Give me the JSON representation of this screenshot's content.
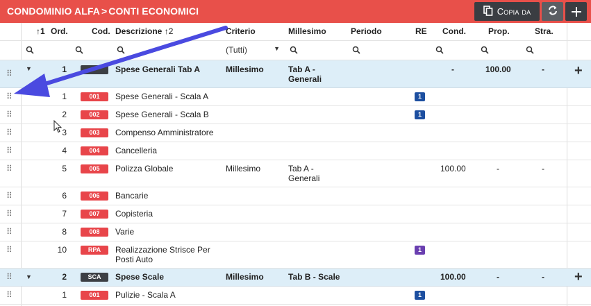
{
  "header": {
    "breadcrumb": [
      "CONDOMINIO ALFA",
      "CONTI ECONOMICI"
    ],
    "separator": ">",
    "copy_label": "Copia da"
  },
  "columns": {
    "ord": "Ord.",
    "cod": "Cod.",
    "descrizione": "Descrizione",
    "criterio": "Criterio",
    "millesimo": "Millesimo",
    "periodo": "Periodo",
    "re": "RE",
    "cond": "Cond.",
    "prop": "Prop.",
    "stra": "Stra.",
    "sort_ord": "1",
    "sort_desc": "2"
  },
  "filters": {
    "criterio_value": "(Tutti)"
  },
  "groups": [
    {
      "ord": "1",
      "cod": "",
      "descrizione": "Spese Generali Tab A",
      "criterio": "Millesimo",
      "millesimo": "Tab A - Generali",
      "cond": "-",
      "prop": "100.00",
      "stra": "-",
      "items": [
        {
          "ord": "1",
          "cod": "001",
          "descrizione": "Spese Generali - Scala A",
          "re": "1"
        },
        {
          "ord": "2",
          "cod": "002",
          "descrizione": "Spese Generali - Scala B",
          "re": "1"
        },
        {
          "ord": "3",
          "cod": "003",
          "descrizione": "Compenso Amministratore"
        },
        {
          "ord": "4",
          "cod": "004",
          "descrizione": "Cancelleria"
        },
        {
          "ord": "5",
          "cod": "005",
          "descrizione": "Polizza Globale",
          "criterio": "Millesimo",
          "millesimo": "Tab A - Generali",
          "cond": "100.00",
          "prop": "-",
          "stra": "-"
        },
        {
          "ord": "6",
          "cod": "006",
          "descrizione": "Bancarie"
        },
        {
          "ord": "7",
          "cod": "007",
          "descrizione": "Copisteria"
        },
        {
          "ord": "8",
          "cod": "008",
          "descrizione": "Varie"
        },
        {
          "ord": "10",
          "cod": "RPA",
          "descrizione": "Realizzazione Strisce Per Posti Auto",
          "re": "1",
          "re_color": "purple"
        }
      ]
    },
    {
      "ord": "2",
      "cod": "SCA",
      "descrizione": "Spese Scale",
      "criterio": "Millesimo",
      "millesimo": "Tab B - Scale",
      "cond": "100.00",
      "prop": "-",
      "stra": "-",
      "items": [
        {
          "ord": "1",
          "cod": "001",
          "descrizione": "Pulizie - Scala A",
          "re": "1"
        }
      ]
    }
  ],
  "colors": {
    "header_bg": "#e8504a",
    "group_row_bg": "#ddeef8",
    "code_badge": "#e8454a",
    "re_badge_blue": "#1d4fa0",
    "re_badge_purple": "#6a3fb0",
    "annotation_arrow": "#4a4ae0"
  }
}
